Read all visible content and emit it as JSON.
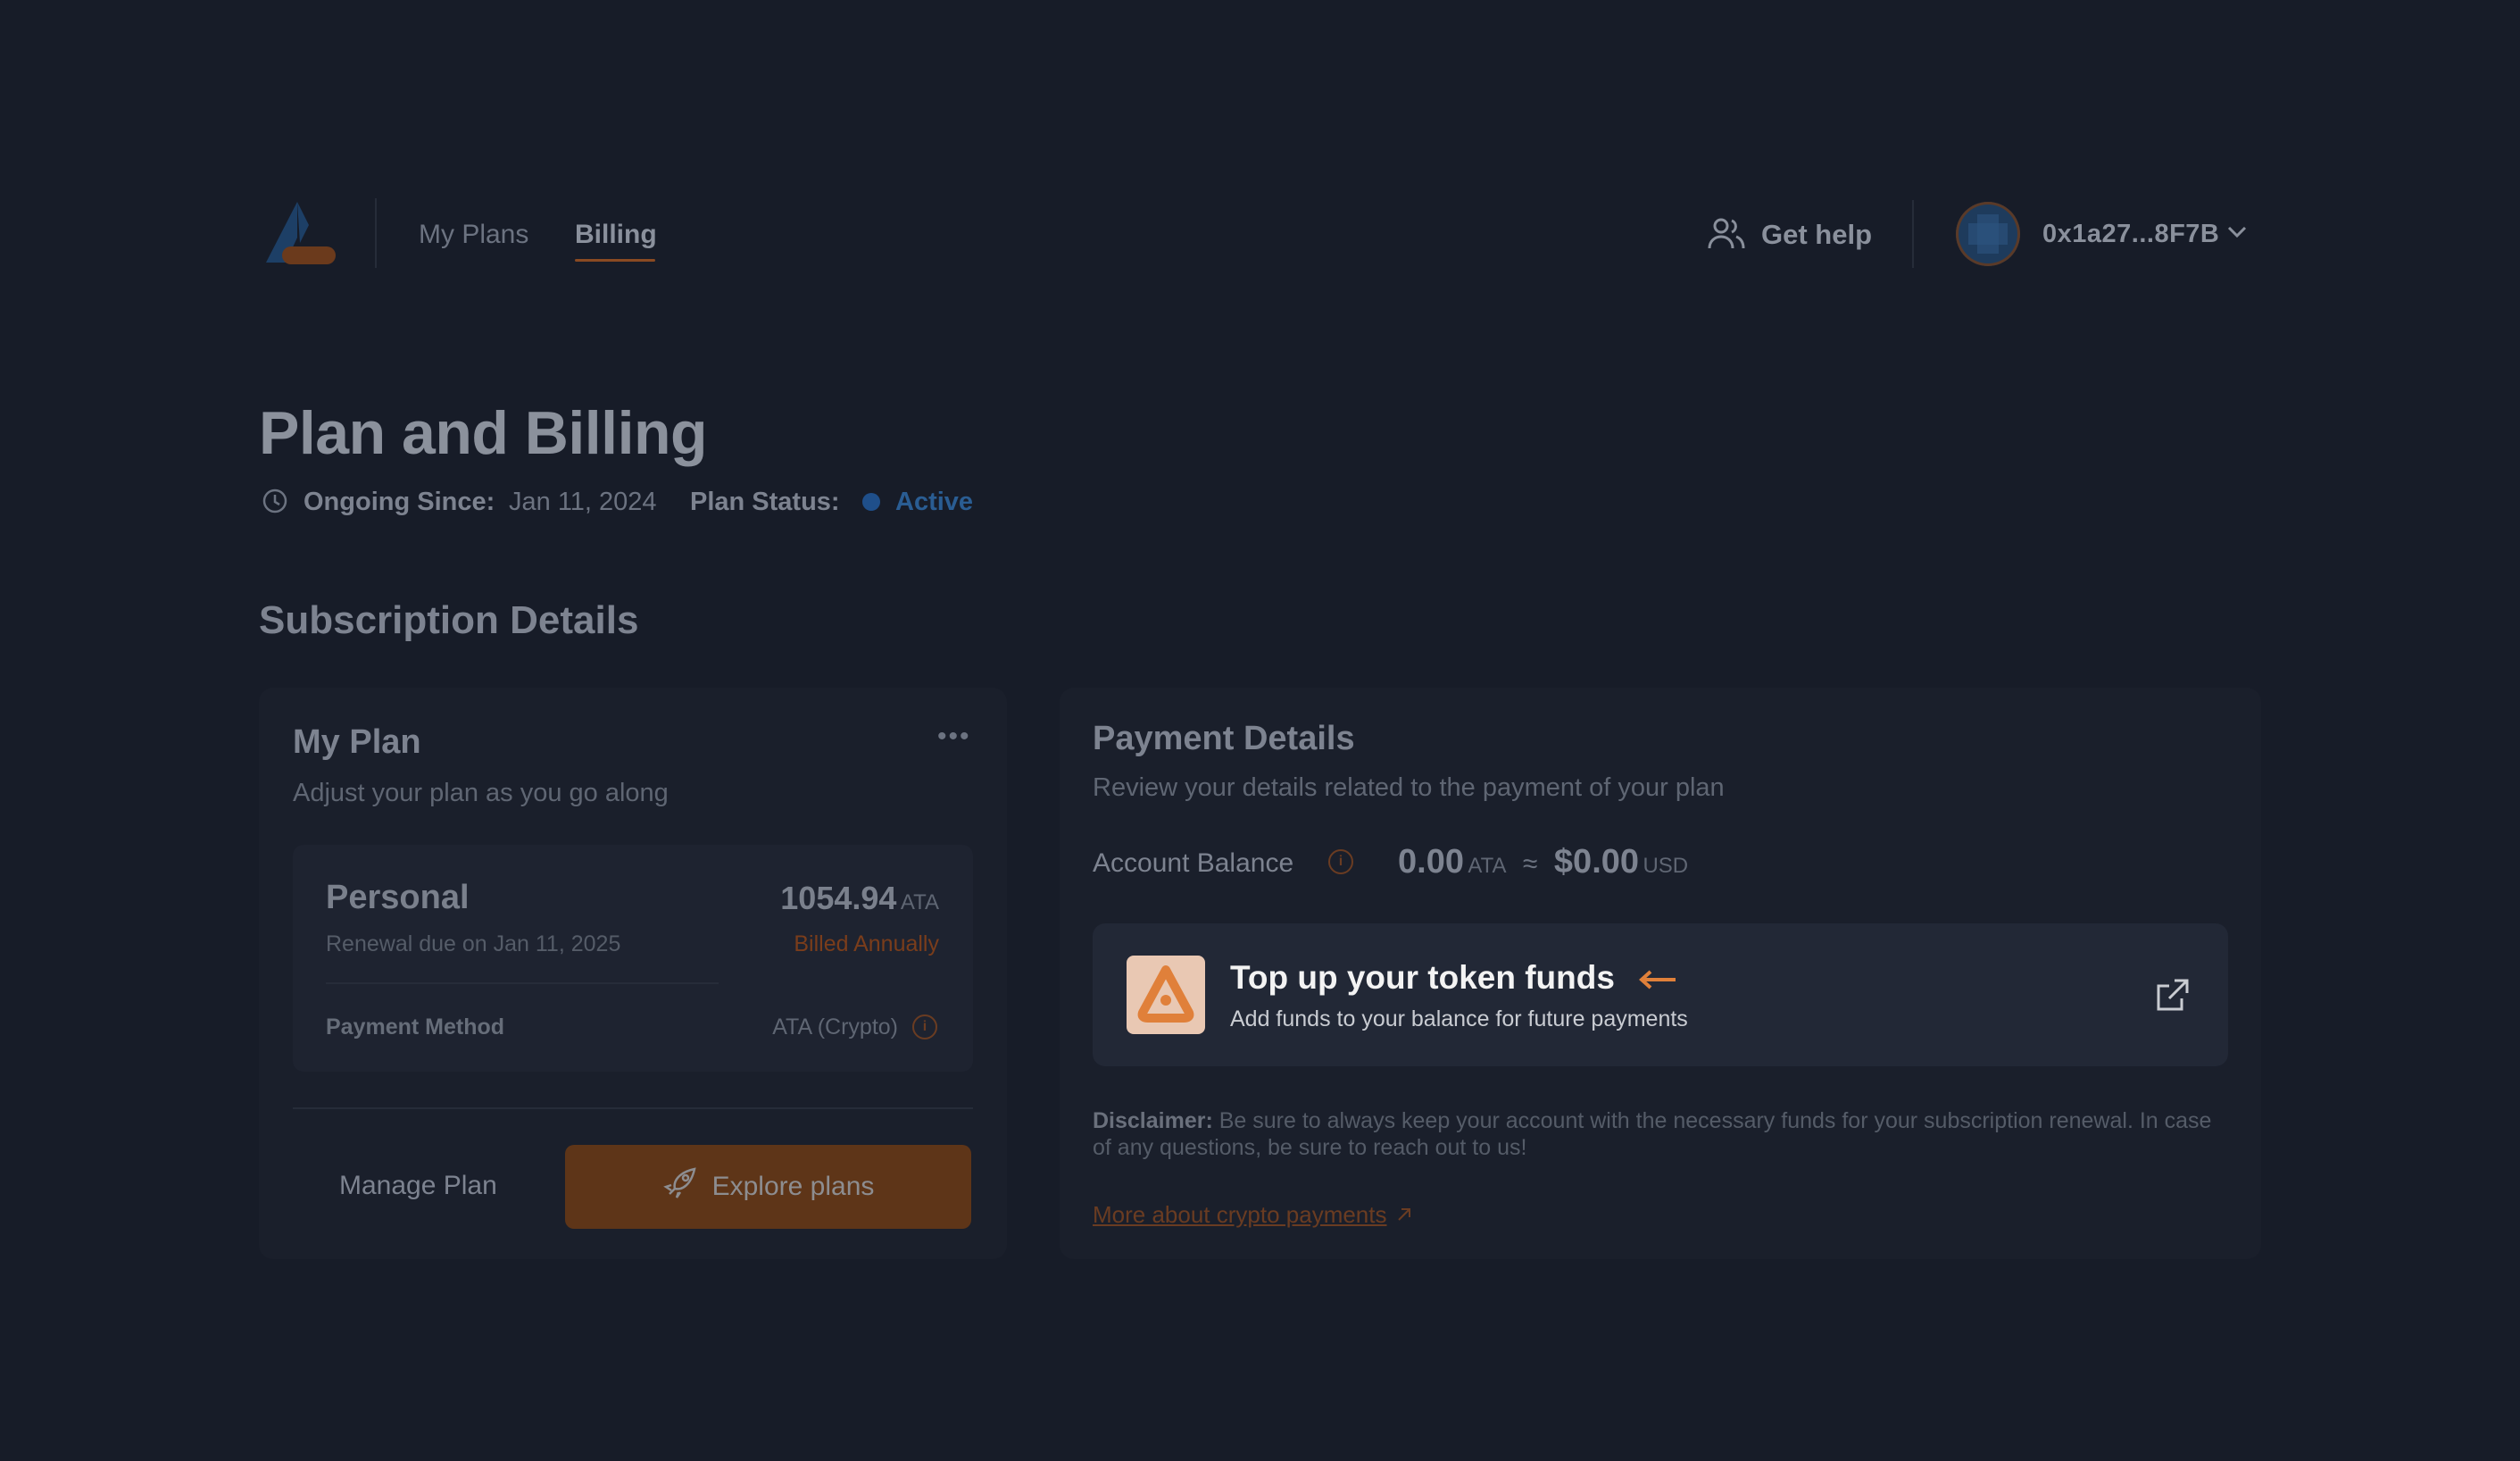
{
  "nav": {
    "my_plans": "My Plans",
    "billing": "Billing"
  },
  "header": {
    "help": "Get help",
    "wallet": "0x1a27...8F7B"
  },
  "page": {
    "title": "Plan and Billing",
    "ongoing_label": "Ongoing Since:",
    "ongoing_value": "Jan 11, 2024",
    "status_label": "Plan Status:",
    "status_value": "Active"
  },
  "section_title": "Subscription Details",
  "my_plan": {
    "title": "My Plan",
    "subtitle": "Adjust your plan as you go along",
    "plan_name": "Personal",
    "price": "1054.94",
    "price_unit": "ATA",
    "renewal": "Renewal due on Jan 11, 2025",
    "billing_cycle": "Billed Annually",
    "payment_method_label": "Payment Method",
    "payment_method_value": "ATA (Crypto)",
    "manage_label": "Manage Plan",
    "explore_label": "Explore plans"
  },
  "payment": {
    "title": "Payment Details",
    "subtitle": "Review your details related to the payment of your plan",
    "balance_label": "Account Balance",
    "balance_token": "0.00",
    "balance_token_unit": "ATA",
    "approx": "≈",
    "balance_usd": "$0.00",
    "balance_usd_unit": "USD",
    "topup_title": "Top up your token funds",
    "topup_sub": "Add funds to your balance for future payments",
    "disclaimer_label": "Disclaimer:",
    "disclaimer_text": "Be sure to always keep your account with the necessary funds for your subscription renewal. In case of any questions, be sure to reach out to us!",
    "crypto_link": "More about crypto payments"
  },
  "colors": {
    "accent": "#e0803a",
    "background": "#171c28",
    "active": "#1f4f8a"
  }
}
